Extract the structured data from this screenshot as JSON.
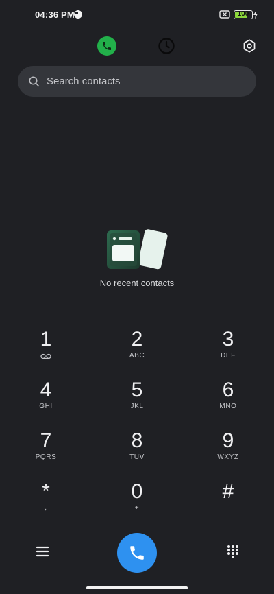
{
  "status_bar": {
    "time": "04:36 PM",
    "battery_level": "100",
    "battery_color": "#8bd63b",
    "icons": [
      "data-saver-icon",
      "no-sim-icon",
      "battery-icon",
      "charging-icon"
    ]
  },
  "top_row": {
    "tabs": [
      {
        "name": "phone",
        "icon": "phone-icon",
        "active": true,
        "accent": "#22b04a"
      },
      {
        "name": "recents",
        "icon": "history-icon",
        "active": false
      }
    ],
    "settings_icon": "settings-hexagon-icon"
  },
  "search": {
    "placeholder": "Search contacts",
    "value": ""
  },
  "empty_state": {
    "message": "No recent contacts"
  },
  "keypad": {
    "keys": [
      {
        "digit": "1",
        "letters": "",
        "sub_icon": "voicemail-icon"
      },
      {
        "digit": "2",
        "letters": "ABC"
      },
      {
        "digit": "3",
        "letters": "DEF"
      },
      {
        "digit": "4",
        "letters": "GHI"
      },
      {
        "digit": "5",
        "letters": "JKL"
      },
      {
        "digit": "6",
        "letters": "MNO"
      },
      {
        "digit": "7",
        "letters": "PQRS"
      },
      {
        "digit": "8",
        "letters": "TUV"
      },
      {
        "digit": "9",
        "letters": "WXYZ"
      },
      {
        "digit": "*",
        "letters": ","
      },
      {
        "digit": "0",
        "letters": "+"
      },
      {
        "digit": "#",
        "letters": ""
      }
    ]
  },
  "bottom": {
    "menu_icon": "menu-icon",
    "call_icon": "phone-icon",
    "call_color": "#2e91f0",
    "dialpad_icon": "dialpad-icon"
  }
}
